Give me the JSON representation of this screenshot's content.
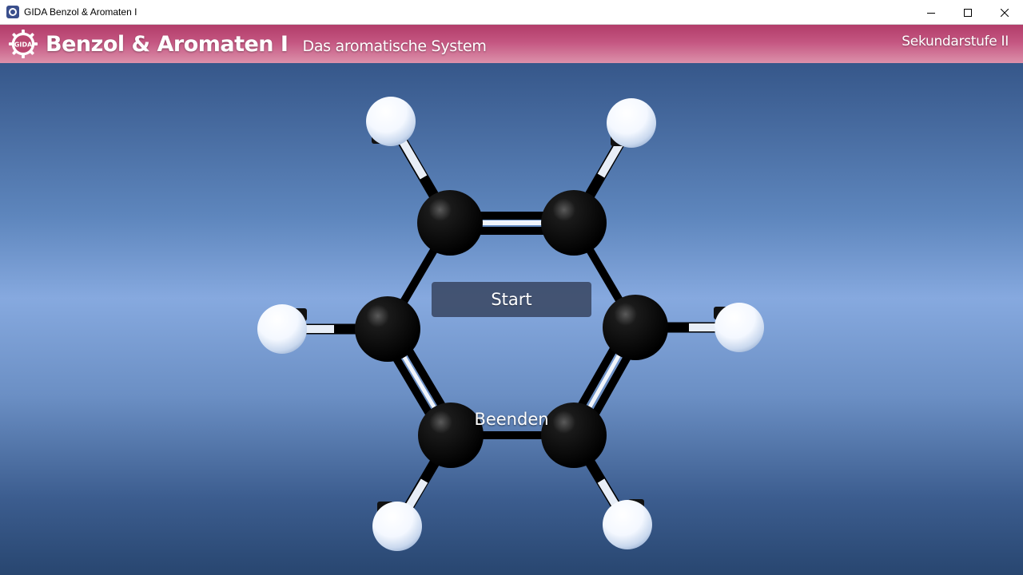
{
  "window": {
    "title": "GIDA Benzol & Aromaten I",
    "controls": [
      "minimize-icon",
      "maximize-icon",
      "close-icon"
    ]
  },
  "header": {
    "logo_text": "GIDA",
    "title": "Benzol & Aromaten I",
    "subtitle": "Das aromatische System",
    "level": "Sekundarstufe II"
  },
  "menu": {
    "start_label": "Start",
    "quit_label": "Beenden"
  },
  "colors": {
    "header_top": "#b23c69",
    "header_bottom": "#dc90aa",
    "scene_mid": "#86a9df",
    "carbon": "#000000",
    "hydrogen": "#ffffff"
  }
}
